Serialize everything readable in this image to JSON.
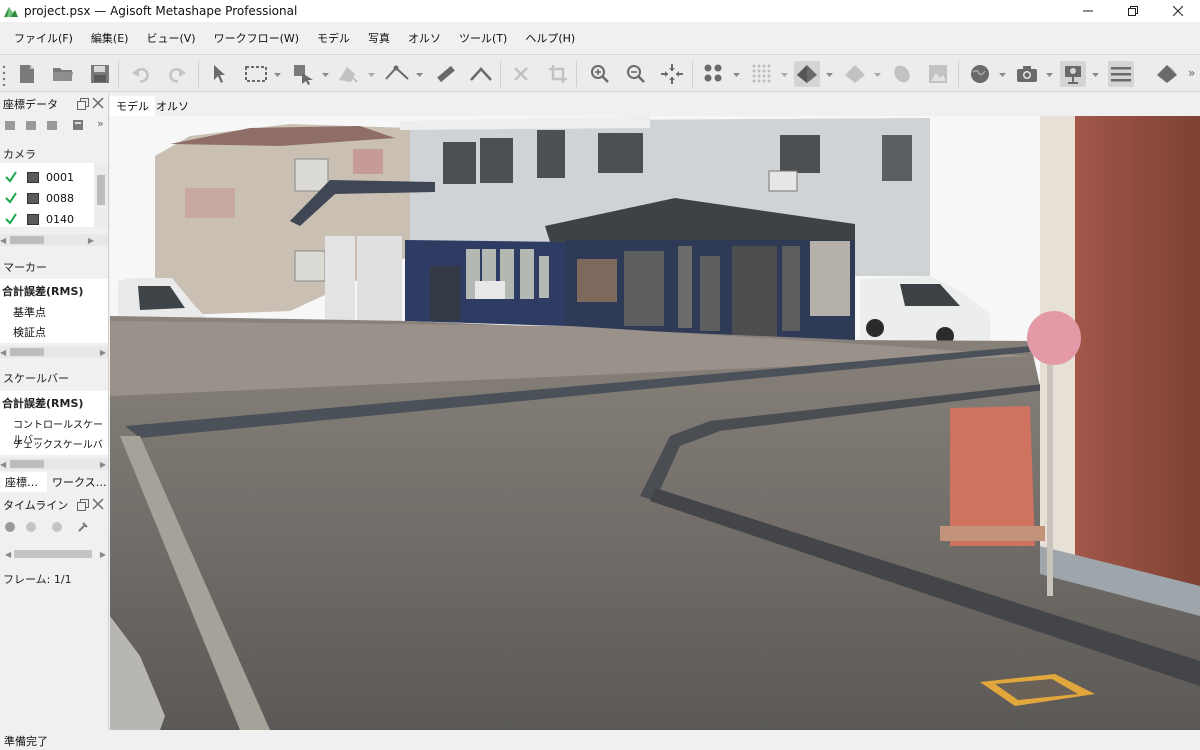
{
  "window": {
    "title": "project.psx — Agisoft Metashape Professional"
  },
  "menu": [
    "ファイル(F)",
    "編集(E)",
    "ビュー(V)",
    "ワークフロー(W)",
    "モデル",
    "写真",
    "オルソ",
    "ツール(T)",
    "ヘルプ(H)"
  ],
  "toolbar": {
    "icons": [
      "new-document-icon",
      "open-folder-icon",
      "save-icon",
      "undo-icon",
      "redo-icon",
      "select-arrow-icon",
      "rectangle-select-icon",
      "paint-select-icon",
      "shape-icon",
      "polyline-icon",
      "ruler-icon",
      "line-icon",
      "delete-icon",
      "crop-icon",
      "zoom-in-icon",
      "zoom-out-icon",
      "reset-view-icon",
      "points-icon",
      "dense-points-icon",
      "solid-model-icon",
      "wireframe-icon",
      "texture-icon",
      "tiled-model-icon",
      "globe-icon",
      "camera-icon",
      "camera-view-icon",
      "menu-icon",
      "shaded-icon"
    ]
  },
  "left_panel": {
    "reference": {
      "title": "座標データ",
      "cameras_label": "カメラ",
      "cameras": [
        {
          "checked": true,
          "label": "0001"
        },
        {
          "checked": true,
          "label": "0088"
        },
        {
          "checked": true,
          "label": "0140"
        }
      ],
      "markers_label": "マーカー",
      "markers_total": "合計誤差(RMS)",
      "markers_items": [
        "基準点",
        "検証点"
      ],
      "scalebars_label": "スケールバー",
      "scalebars_total": "合計誤差(RMS)",
      "scalebars_items": [
        "コントロールスケールバー",
        "チェックスケールバー"
      ]
    },
    "tabs": [
      "座標…",
      "ワークス…"
    ],
    "timeline": {
      "title": "タイムライン",
      "frame": "フレーム: 1/1"
    }
  },
  "view_tabs": [
    "モデル",
    "オルソ"
  ],
  "status": "準備完了",
  "colors": {
    "accent_check": "#1aa64a",
    "sky": "#f6f6f6",
    "building_white": "#cfd3d6",
    "shop_navy": "#2e3b62",
    "asphalt": "#6e6b68",
    "brick": "#8b4a3a",
    "fire_box": "#cf7260"
  }
}
